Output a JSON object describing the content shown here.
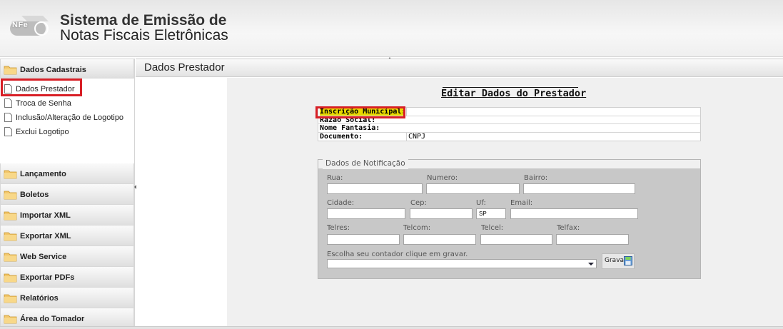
{
  "header": {
    "logo_text": "NFe",
    "title_line1": "Sistema de Emissão de",
    "title_line2": "Notas Fiscais Eletrônicas"
  },
  "sidebar": {
    "sections": [
      {
        "label": "Dados Cadastrais",
        "expanded": true,
        "items": [
          {
            "label": "Dados Prestador",
            "selected": true
          },
          {
            "label": "Troca de Senha"
          },
          {
            "label": "Inclusão/Alteração de Logotipo"
          },
          {
            "label": "Exclui Logotipo"
          }
        ]
      },
      {
        "label": "Lançamento"
      },
      {
        "label": "Boletos"
      },
      {
        "label": "Importar XML"
      },
      {
        "label": "Exportar XML"
      },
      {
        "label": "Web Service"
      },
      {
        "label": "Exportar PDFs"
      },
      {
        "label": "Relatórios"
      },
      {
        "label": "Área do Tomador"
      }
    ]
  },
  "main": {
    "panel_title": "Dados Prestador",
    "form_title": "Editar Dados do Prestador",
    "info": {
      "inscricao_label": "Inscrição Municipal:",
      "inscricao_value": "",
      "razao_label": "Razão Social:",
      "razao_value": "",
      "fantasia_label": "Nome Fantasia:",
      "fantasia_value": "",
      "documento_label": "Documento:",
      "documento_value": "CNPJ"
    },
    "notificacao": {
      "legend": "Dados de Notificação",
      "rua_label": "Rua:",
      "numero_label": "Numero:",
      "bairro_label": "Bairro:",
      "cidade_label": "Cidade:",
      "cep_label": "Cep:",
      "uf_label": "Uf:",
      "uf_value": "SP",
      "email_label": "Email:",
      "telres_label": "Telres:",
      "telcom_label": "Telcom:",
      "telcel_label": "Telcel:",
      "telfax_label": "Telfax:",
      "contador_label": "Escolha seu contador clique em gravar.",
      "contador_selected": "",
      "gravar_label": "Gravar"
    }
  },
  "colors": {
    "highlight_red": "#d81f26",
    "inscricao_yellow": "#e8d800",
    "panel_gray": "#c8c8c8"
  }
}
